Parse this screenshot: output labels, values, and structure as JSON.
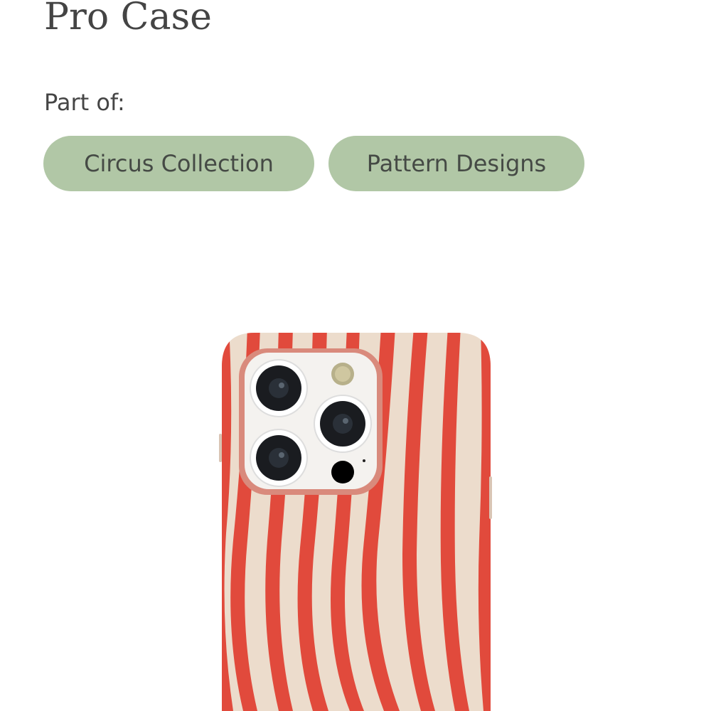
{
  "product": {
    "title": "Pro Case"
  },
  "collections": {
    "label": "Part of:",
    "tags": [
      {
        "label": "Circus Collection"
      },
      {
        "label": "Pattern Designs"
      }
    ]
  },
  "colors": {
    "tag_background": "#b1c7a6",
    "case_base": "#ecdccc",
    "stripe": "#e14a3c",
    "text": "#454545"
  }
}
